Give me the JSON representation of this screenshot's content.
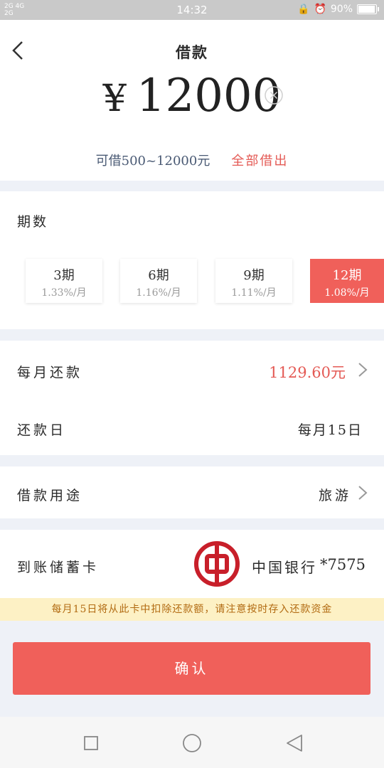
{
  "status": {
    "network_top": "2G 4G",
    "network_bottom": "2G",
    "time": "14:32",
    "battery": "90%",
    "battery_level": 0.9
  },
  "header": {
    "title": "借款",
    "currency": "¥",
    "amount": "12000",
    "range": "可借500~12000元",
    "borrow_all": "全部借出"
  },
  "periods": {
    "label": "期数",
    "options": [
      {
        "n": "3期",
        "rate": "1.33%/月",
        "selected": false
      },
      {
        "n": "6期",
        "rate": "1.16%/月",
        "selected": false
      },
      {
        "n": "9期",
        "rate": "1.11%/月",
        "selected": false
      },
      {
        "n": "12期",
        "rate": "1.08%/月",
        "selected": true
      }
    ]
  },
  "repayment": {
    "monthly_label": "每月还款",
    "monthly_value": "1129.60元",
    "day_label": "还款日",
    "day_value": "每月15日"
  },
  "purpose": {
    "label": "借款用途",
    "value": "旅游"
  },
  "bank": {
    "label": "到账储蓄卡",
    "name": "中国银行",
    "card": "*7575",
    "logo_color": "#c81f2a"
  },
  "notice": "每月15日将从此卡中扣除还款额，请注意按时存入还款资金",
  "confirm_label": "确认",
  "colors": {
    "accent": "#f0605a",
    "notice_bg": "#fdf1c5",
    "notice_text": "#b26b12"
  }
}
